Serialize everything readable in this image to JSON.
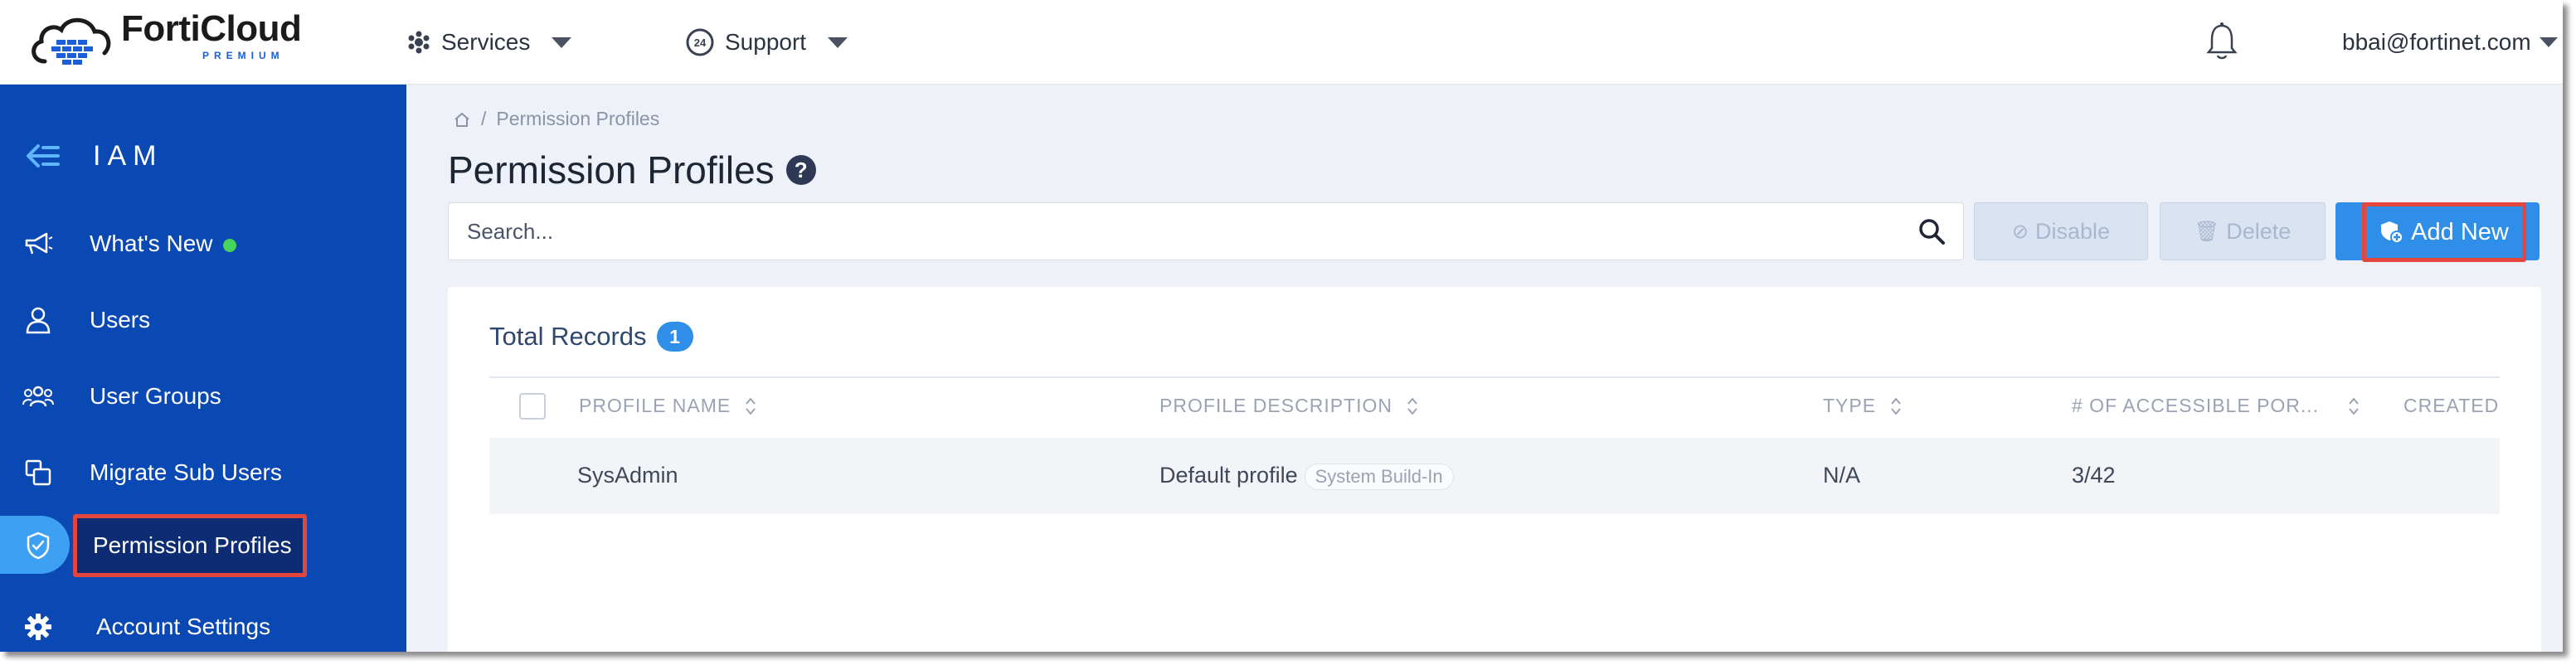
{
  "brand": {
    "name": "FortiCloud",
    "edition": "PREMIUM",
    "accent": "#1a5fd7"
  },
  "topnav": {
    "items": [
      {
        "label": "Services",
        "icon": "services-icon"
      },
      {
        "label": "Support",
        "icon": "support-24-icon"
      }
    ],
    "notifications_icon": "bell-icon",
    "user": "bbai@fortinet.com"
  },
  "sidebar": {
    "title": "IAM",
    "back_icon": "collapse-arrow-icon",
    "items": [
      {
        "label": "What's New",
        "icon": "megaphone-icon",
        "has_dot": true
      },
      {
        "label": "Users",
        "icon": "user-icon"
      },
      {
        "label": "User Groups",
        "icon": "user-groups-icon"
      },
      {
        "label": "Migrate Sub Users",
        "icon": "migrate-icon"
      },
      {
        "label": "Permission Profiles",
        "icon": "shield-icon",
        "active": true
      },
      {
        "label": "Account Settings",
        "icon": "gear-icon"
      }
    ],
    "bg_color": "#0a48b4",
    "active_color": "#3ea0f2"
  },
  "breadcrumb": {
    "home_icon": "home-icon",
    "current": "Permission Profiles"
  },
  "page": {
    "title": "Permission Profiles",
    "help": "?"
  },
  "search": {
    "placeholder": "Search..."
  },
  "actions": {
    "disable": "Disable",
    "delete": "Delete",
    "add_new": "Add New"
  },
  "records": {
    "label": "Total Records",
    "count": "1",
    "columns": [
      "PROFILE NAME",
      "PROFILE DESCRIPTION",
      "TYPE",
      "# OF ACCESSIBLE POR...",
      "CREATED"
    ],
    "rows": [
      {
        "name": "SysAdmin",
        "description": "Default profile",
        "tag": "System Build-In",
        "type": "N/A",
        "portals": "3/42"
      }
    ]
  },
  "highlight_color": "#e2463c"
}
